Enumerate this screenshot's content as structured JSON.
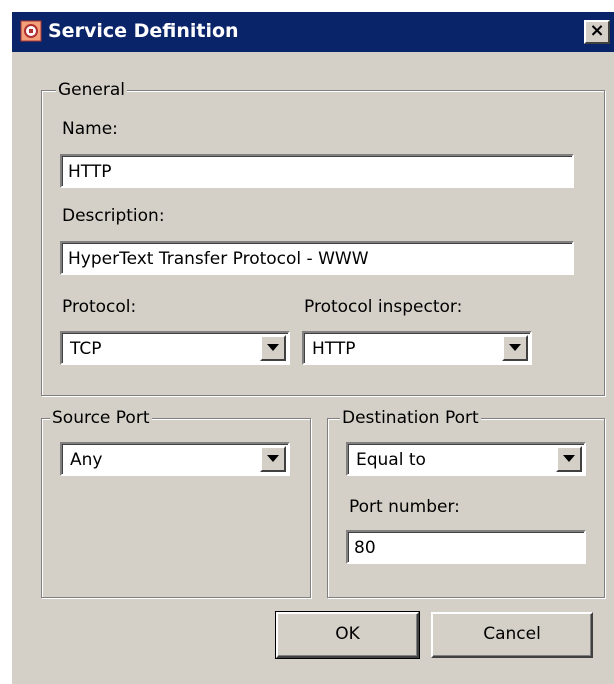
{
  "window": {
    "title": "Service Definition",
    "close_symbol": "×"
  },
  "general": {
    "legend": "General",
    "name_label": "Name:",
    "name_value": "HTTP",
    "description_label": "Description:",
    "description_value": "HyperText Transfer Protocol - WWW",
    "protocol_label": "Protocol:",
    "protocol_value": "TCP",
    "inspector_label": "Protocol inspector:",
    "inspector_value": "HTTP"
  },
  "source_port": {
    "legend": "Source Port",
    "value": "Any"
  },
  "destination_port": {
    "legend": "Destination Port",
    "mode_value": "Equal to",
    "port_label": "Port number:",
    "port_value": "80"
  },
  "buttons": {
    "ok": "OK",
    "cancel": "Cancel"
  },
  "colors": {
    "titlebar": "#0a246a",
    "window": "#d4d0c8"
  }
}
